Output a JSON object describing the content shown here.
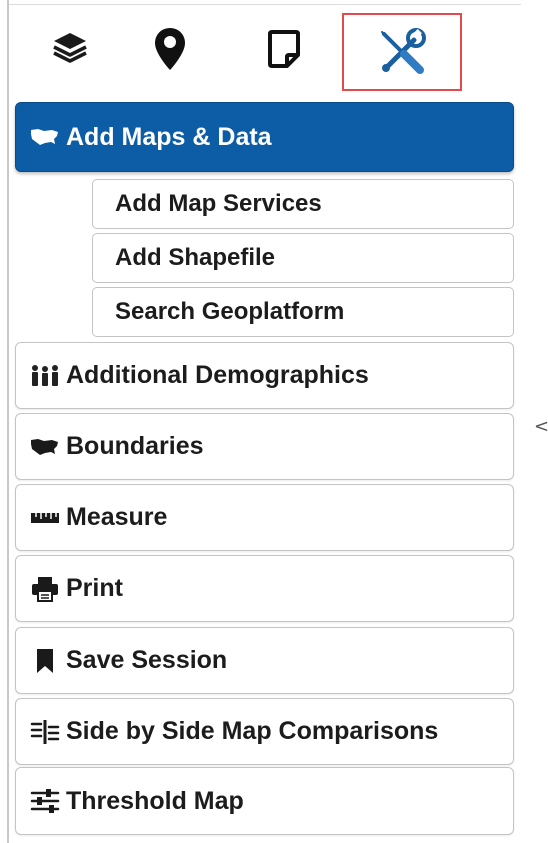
{
  "tabs": [
    {
      "icon": "layers-icon",
      "active": false
    },
    {
      "icon": "map-pin-icon",
      "active": false
    },
    {
      "icon": "note-icon",
      "active": false
    },
    {
      "icon": "tools-icon",
      "active": true
    }
  ],
  "menu": {
    "add_maps": {
      "label": "Add Maps & Data",
      "icon": "us-map-icon",
      "expanded": true
    },
    "sub_items": [
      {
        "label": "Add Map Services"
      },
      {
        "label": "Add Shapefile"
      },
      {
        "label": "Search Geoplatform"
      }
    ],
    "items": [
      {
        "label": "Additional Demographics",
        "icon": "people-icon"
      },
      {
        "label": "Boundaries",
        "icon": "us-map-icon"
      },
      {
        "label": "Measure",
        "icon": "ruler-icon"
      },
      {
        "label": "Print",
        "icon": "printer-icon"
      },
      {
        "label": "Save Session",
        "icon": "bookmark-icon"
      },
      {
        "label": "Side by Side Map Comparisons",
        "icon": "columns-icon"
      },
      {
        "label": "Threshold Map",
        "icon": "sliders-icon"
      }
    ]
  },
  "collapse_handle": "<",
  "colors": {
    "active_background": "#0d5ca6",
    "active_tab_border": "#e24b4b",
    "text": "#1c1c1c"
  }
}
